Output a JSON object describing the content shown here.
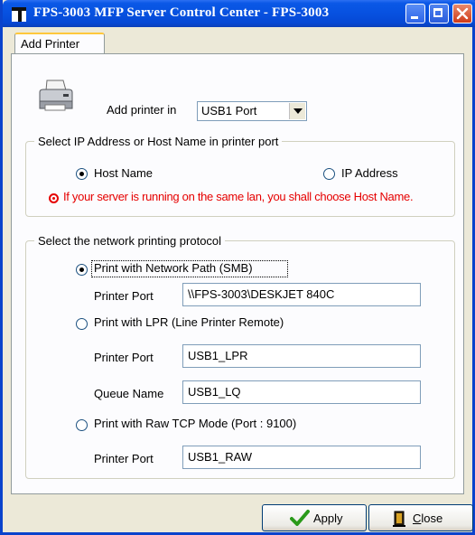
{
  "window": {
    "title": "FPS-3003 MFP Server Control Center - FPS-3003",
    "icons": {
      "app": "app-icon",
      "minimize": "minimize-icon",
      "maximize": "maximize-icon",
      "close": "close-icon"
    }
  },
  "tabs": [
    {
      "label": "Add Printer",
      "active": true
    }
  ],
  "add_printer": {
    "label": "Add printer in",
    "port_select_value": "USB1 Port",
    "printer_icon": "printer-icon"
  },
  "address_group": {
    "legend": "Select IP Address or Host Name in printer port",
    "host_name_label": "Host Name",
    "host_name_checked": true,
    "ip_address_label": "IP Address",
    "ip_address_checked": false,
    "warning": "If your server is running on the same lan, you shall choose Host Name.",
    "warning_color": "#e60000"
  },
  "protocol_group": {
    "legend": "Select the network printing protocol",
    "smb": {
      "label": "Print with Network Path (SMB)",
      "checked": true,
      "port_label": "Printer Port",
      "port_value": "\\\\FPS-3003\\DESKJET 840C"
    },
    "lpr": {
      "label": "Print with LPR (Line Printer Remote)",
      "checked": false,
      "port_label": "Printer Port",
      "port_value": "USB1_LPR",
      "queue_label": "Queue Name",
      "queue_value": "USB1_LQ"
    },
    "raw": {
      "label": "Print with Raw TCP Mode (Port : 9100)",
      "checked": false,
      "port_label": "Printer Port",
      "port_value": "USB1_RAW"
    }
  },
  "buttons": {
    "apply_label": "Apply",
    "apply_icon": "checkmark-icon",
    "close_label": "Close",
    "close_underline": "C",
    "close_rest": "lose",
    "close_icon": "door-exit-icon"
  },
  "colors": {
    "title_bar": "#0751e0",
    "window_bg": "#ece9d8",
    "accent_tab": "#ffc83c"
  }
}
